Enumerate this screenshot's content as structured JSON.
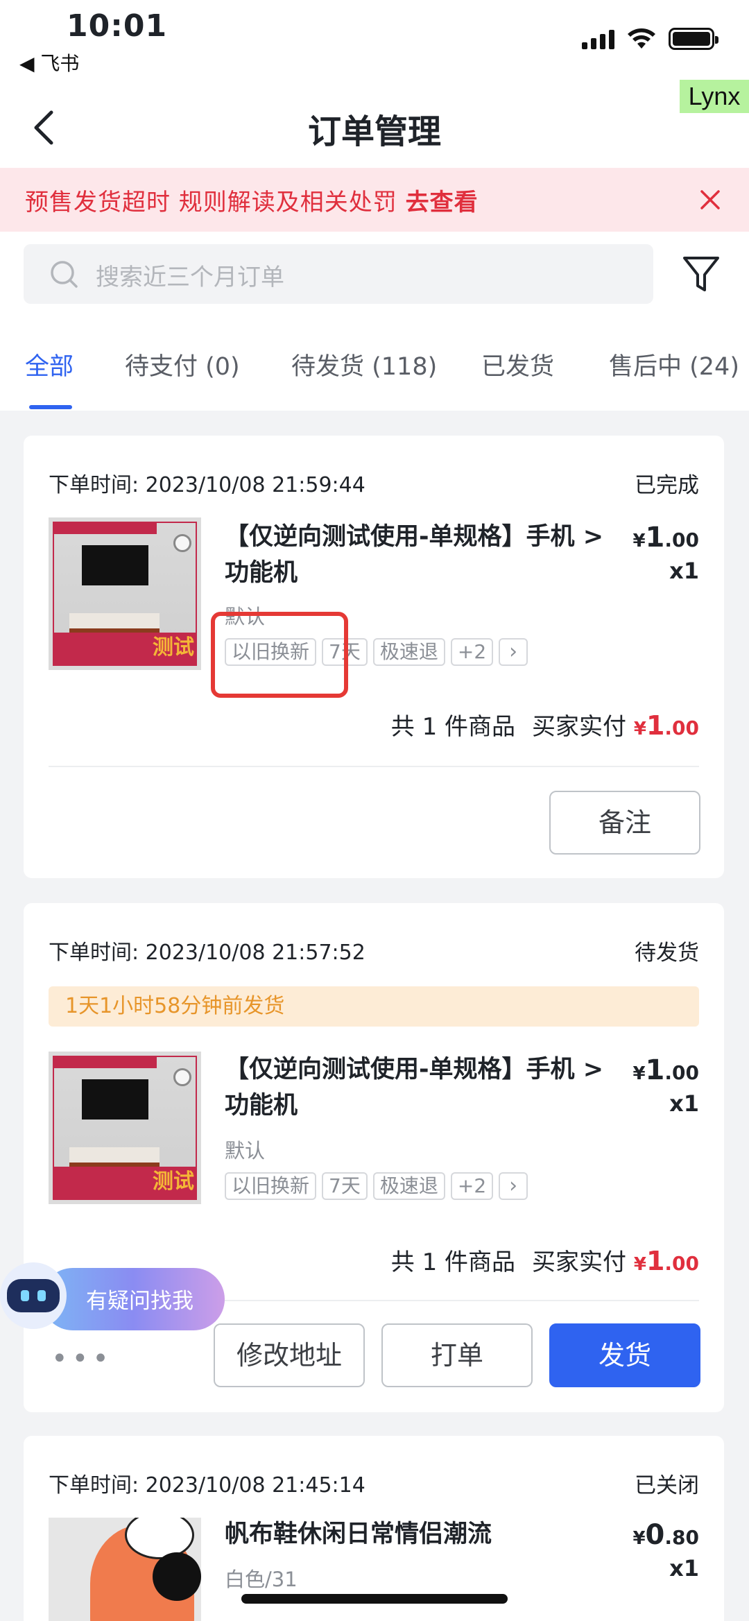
{
  "status_bar": {
    "time": "10:01",
    "back_app": "◀ 飞书"
  },
  "nav": {
    "title": "订单管理",
    "badge": "Lynx"
  },
  "notice": {
    "text": "预售发货超时 规则解读及相关处罚 ",
    "link": "去查看"
  },
  "search": {
    "placeholder": "搜索近三个月订单"
  },
  "tabs": [
    {
      "label": "全部",
      "active": true
    },
    {
      "label": "待支付 (0)"
    },
    {
      "label": "待发货 (118)"
    },
    {
      "label": "已发货"
    },
    {
      "label": "售后中 (24)"
    }
  ],
  "orders": [
    {
      "time": "下单时间: 2023/10/08 21:59:44",
      "status": "已完成",
      "title": "【仅逆向测试使用-单规格】手机 > 功能机",
      "price_cur": "¥",
      "price_int": "1",
      "price_dec": ".00",
      "qty": "x1",
      "spec": "默认",
      "tags": [
        "以旧换新",
        "7天",
        "极速退",
        "+2",
        "›"
      ],
      "count_label": "共 1 件商品",
      "pay_label": "买家实付",
      "pay_cur": "¥",
      "pay_int": "1",
      "pay_dec": ".00",
      "buttons": [
        "备注"
      ]
    },
    {
      "time": "下单时间: 2023/10/08 21:57:52",
      "status": "待发货",
      "countdown": "1天1小时58分钟前发货",
      "title": "【仅逆向测试使用-单规格】手机 > 功能机",
      "price_cur": "¥",
      "price_int": "1",
      "price_dec": ".00",
      "qty": "x1",
      "spec": "默认",
      "tags": [
        "以旧换新",
        "7天",
        "极速退",
        "+2",
        "›"
      ],
      "count_label": "共 1 件商品",
      "pay_label": "买家实付",
      "pay_cur": "¥",
      "pay_int": "1",
      "pay_dec": ".00",
      "more": "•••",
      "buttons": [
        "修改地址",
        "打单",
        "发货"
      ]
    },
    {
      "time": "下单时间: 2023/10/08 21:45:14",
      "status": "已关闭",
      "title": "帆布鞋休闲日常情侣潮流",
      "price_cur": "¥",
      "price_int": "0",
      "price_dec": ".80",
      "qty": "x1",
      "spec": "白色/31"
    }
  ],
  "assistant": {
    "label": "有疑问找我"
  },
  "colors": {
    "accent": "#2f63f0",
    "danger": "#e02f3d",
    "warning": "#e7952a"
  }
}
